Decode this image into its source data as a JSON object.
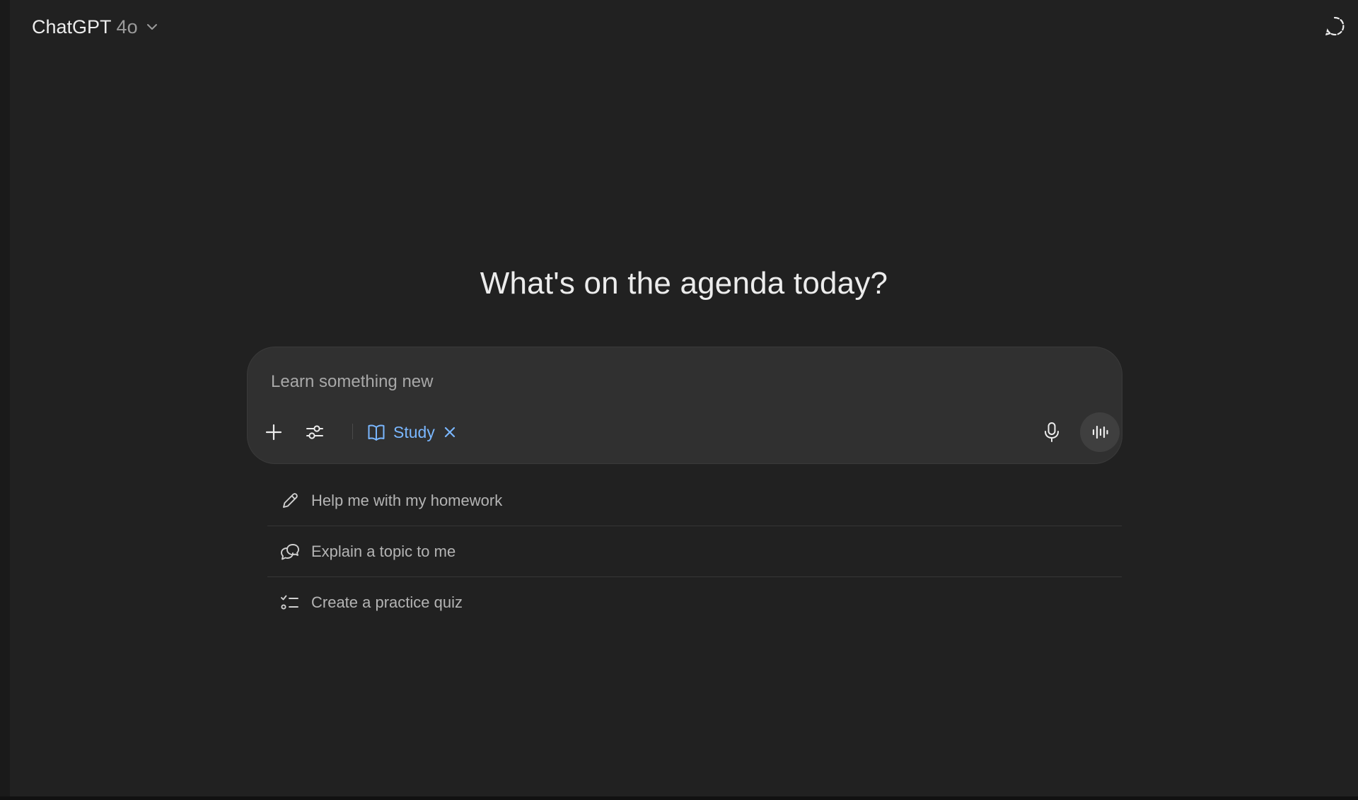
{
  "header": {
    "model_name": "ChatGPT",
    "model_version": "4o",
    "model_dropdown_icon": "chevron-down-icon",
    "temporary_chat_icon": "dashed-circle-chat-icon"
  },
  "headline": "What's on the agenda today?",
  "composer": {
    "placeholder": "Learn something new",
    "value": "",
    "add_icon": "plus-icon",
    "tools_icon": "sliders-icon",
    "mode_chip": {
      "label": "Study",
      "icon": "book-open-icon",
      "remove_icon": "close-icon"
    },
    "mic_icon": "microphone-icon",
    "voice_icon": "voice-waveform-icon"
  },
  "suggestions": [
    {
      "label": "Help me with my homework",
      "icon": "pencil-icon"
    },
    {
      "label": "Explain a topic to me",
      "icon": "chat-bubbles-icon"
    },
    {
      "label": "Create a practice quiz",
      "icon": "checklist-icon"
    }
  ],
  "colors": {
    "background": "#212121",
    "composer": "#303030",
    "accent": "#7ab7ff",
    "text": "#ececec",
    "muted": "#b4b4b4"
  }
}
